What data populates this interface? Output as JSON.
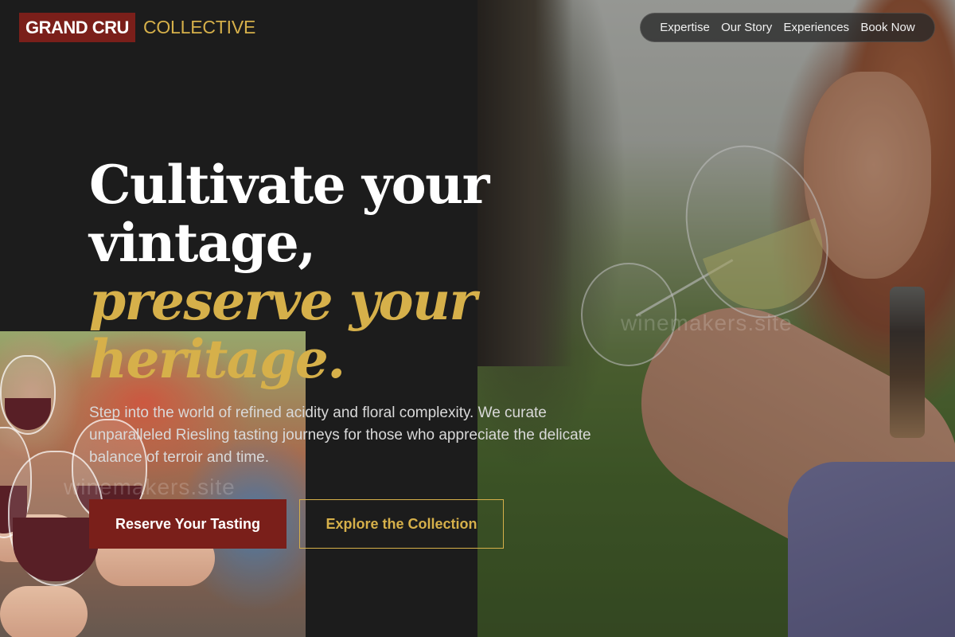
{
  "brand": {
    "badge": "GRAND CRU",
    "name": "COLLECTIVE",
    "badge_color": "#7a1f1a",
    "accent_color": "#d6b04a"
  },
  "nav": {
    "items": [
      {
        "label": "Expertise"
      },
      {
        "label": "Our Story"
      },
      {
        "label": "Experiences"
      },
      {
        "label": "Book Now"
      }
    ]
  },
  "hero": {
    "headline_line1": "Cultivate your",
    "headline_line2": "vintage,",
    "headline_italic1": "preserve your",
    "headline_italic2": "heritage.",
    "subcopy": "Step into the world of refined acidity and floral complexity. We curate unparalleled Riesling tasting journeys for those who appreciate the delicate balance of terroir and time.",
    "primary_cta": "Reserve Your Tasting",
    "secondary_cta": "Explore the Collection"
  },
  "watermark": {
    "text_right": "winemakers.site",
    "text_left": "winemakers.site"
  },
  "images": {
    "right_photo": "woman-sipping-white-wine-photo",
    "left_photo": "red-wine-toast-photo"
  }
}
